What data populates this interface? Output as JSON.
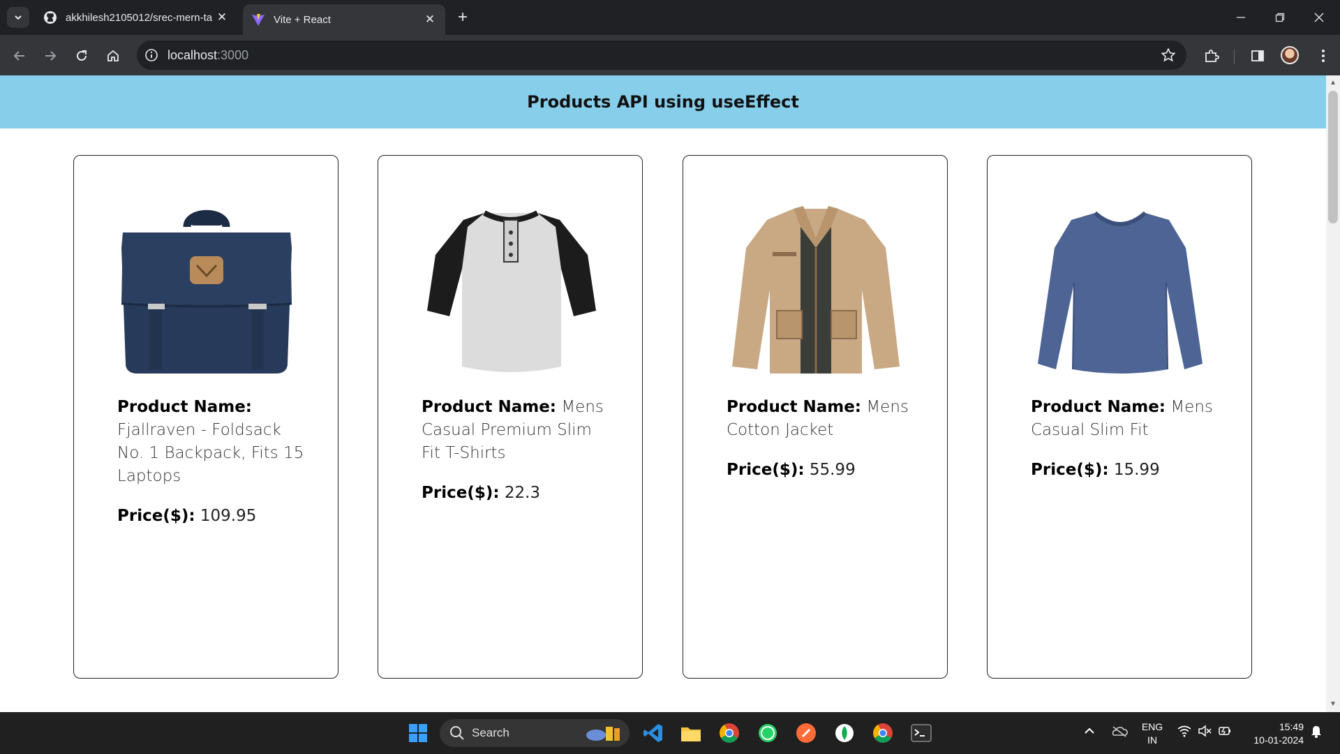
{
  "browser": {
    "tabs": [
      {
        "title": "akkhilesh2105012/srec-mern-ta",
        "icon": "github-icon",
        "active": false
      },
      {
        "title": "Vite + React",
        "icon": "vite-icon",
        "active": true
      }
    ],
    "url_host": "localhost",
    "url_port": ":3000"
  },
  "page": {
    "heading": "Products API using useEffect",
    "name_label": "Product Name:",
    "price_label": "Price($):",
    "products": [
      {
        "name": "Fjallraven - Foldsack No. 1 Backpack, Fits 15 Laptops",
        "price": "109.95",
        "image": "backpack-image"
      },
      {
        "name": "Mens Casual Premium Slim Fit T-Shirts",
        "price": "22.3",
        "image": "tshirt-image"
      },
      {
        "name": "Mens Cotton Jacket",
        "price": "55.99",
        "image": "jacket-image"
      },
      {
        "name": "Mens Casual Slim Fit",
        "price": "15.99",
        "image": "longsleeve-image"
      }
    ]
  },
  "taskbar": {
    "search_label": "Search",
    "language": [
      "ENG",
      "IN"
    ],
    "time": "15:49",
    "date": "10-01-2024"
  },
  "colors": {
    "header_bg": "#87ceeb",
    "chrome_dark": "#202124",
    "chrome_toolbar": "#35363a"
  }
}
